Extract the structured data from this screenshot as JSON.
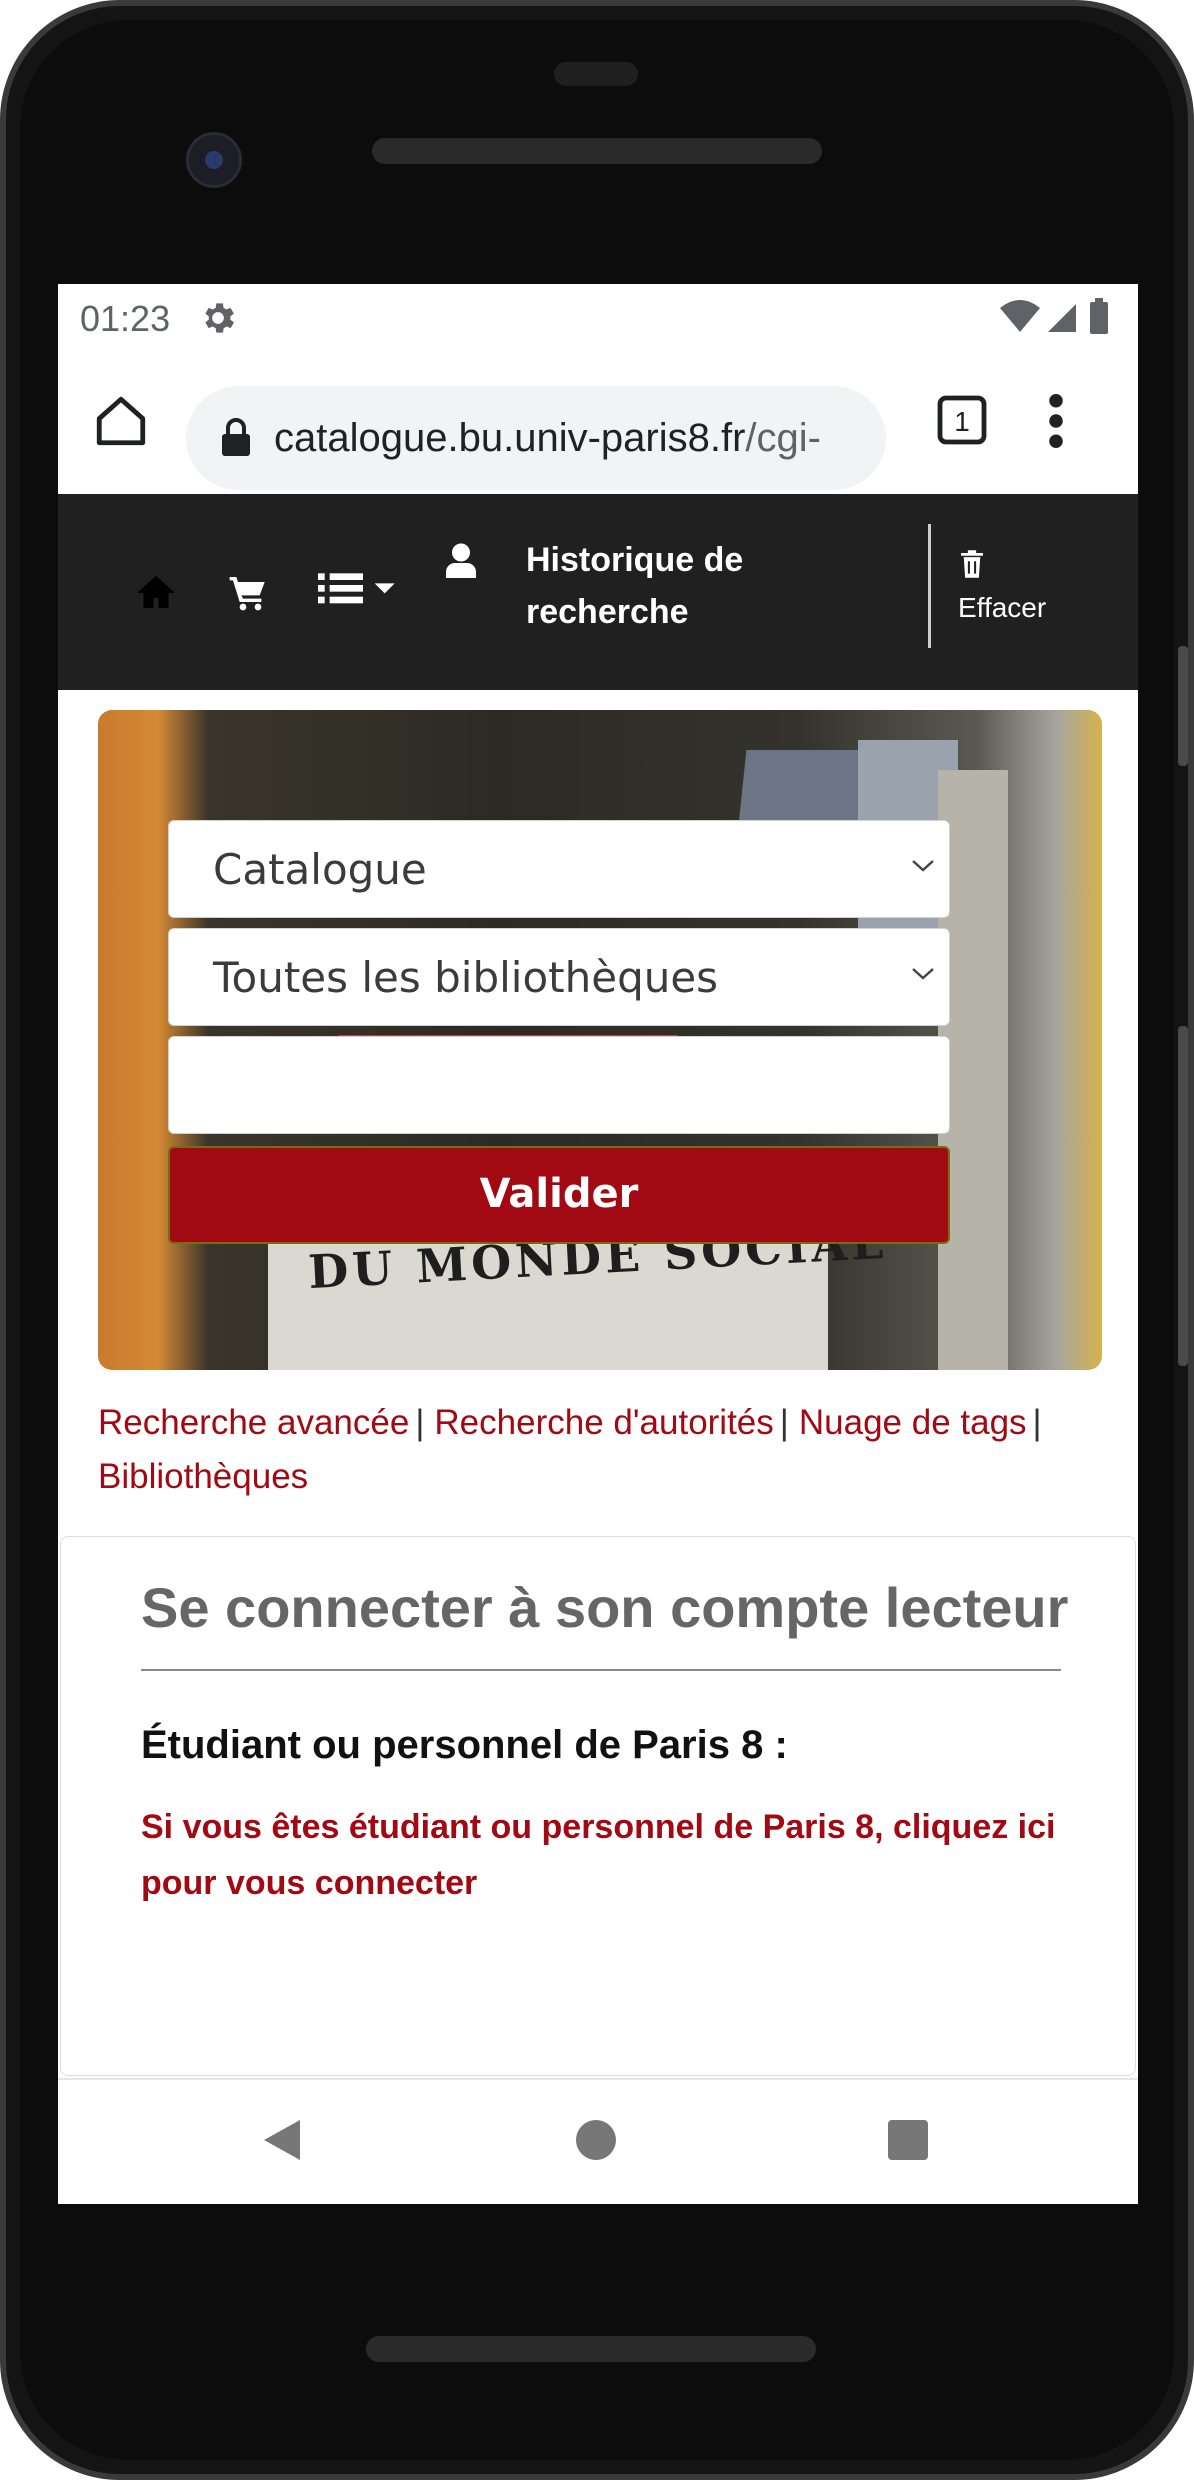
{
  "status_bar": {
    "time": "01:23",
    "icons": [
      "gear-icon",
      "wifi-icon",
      "signal-icon",
      "battery-icon"
    ]
  },
  "browser": {
    "url_host": "catalogue.bu.univ-paris8.fr",
    "url_path": "/cgi-",
    "tab_count": "1",
    "icons": [
      "home-icon",
      "lock-icon",
      "tabs-icon",
      "overflow-menu-icon"
    ]
  },
  "navbar": {
    "history_label": "Historique de recherche",
    "clear_label": "Effacer",
    "icons": [
      "home-icon",
      "cart-icon",
      "list-icon",
      "caret-down-icon",
      "user-icon",
      "trash-icon"
    ]
  },
  "search": {
    "scope_selected": "Catalogue",
    "library_selected": "Toutes les bibliothèques",
    "query_value": "",
    "submit_label": "Valider"
  },
  "links": {
    "advanced": "Recherche avancée",
    "authorities": "Recherche d'autorités",
    "tags": "Nuage de tags",
    "libraries": "Bibliothèques",
    "separator": "|"
  },
  "login": {
    "title": "Se connecter à son compte lecteur",
    "subtitle": "Étudiant ou personnel de Paris 8 :",
    "link_text": "Si vous êtes étudiant ou personnel de Paris 8, cliquez ici pour vous connecter"
  },
  "hero_image_text": "DU MONDE SOCIAL",
  "colors": {
    "accent": "#a20a13",
    "navbar_bg": "#202020",
    "omnibox_bg": "#f1f3f4"
  }
}
